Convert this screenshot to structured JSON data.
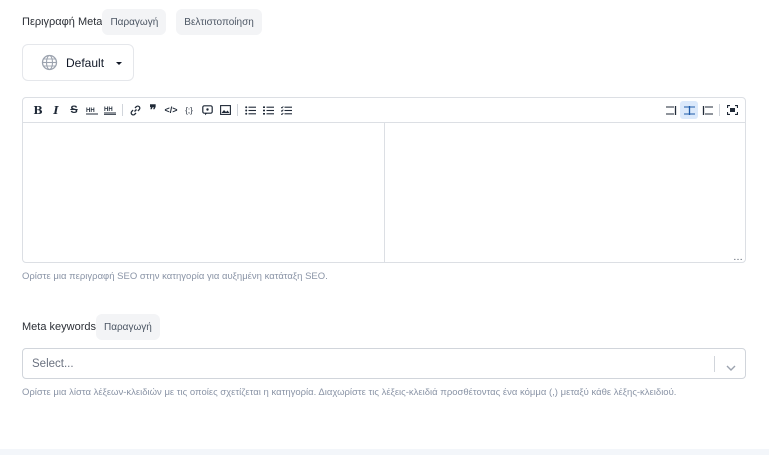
{
  "meta_description": {
    "label": "Περιγραφή Meta",
    "pills": [
      "Παραγωγή",
      "Βελτιστοποίηση"
    ],
    "locale_button": {
      "label": "Default",
      "icon": "globe-icon"
    },
    "toolbar_left": [
      "bold-icon",
      "italic-icon",
      "strikethrough-icon",
      "heading-icon",
      "heading-alt-icon",
      "link-icon",
      "quote-icon",
      "code-icon",
      "code-block-icon",
      "comment-icon",
      "image-icon",
      "unordered-list-icon",
      "ordered-list-icon",
      "checklist-icon"
    ],
    "toolbar_right": [
      "editor-only-icon",
      "split-view-icon",
      "preview-only-icon",
      "fullscreen-icon"
    ],
    "help": "Ορίστε μια περιγραφή SEO στην κατηγορία για αυξημένη κατάταξη SEO."
  },
  "meta_keywords": {
    "label": "Meta keywords",
    "pills": [
      "Παραγωγή"
    ],
    "select_placeholder": "Select...",
    "help": "Ορίστε μια λίστα λέξεων-κλειδιών με τις οποίες σχετίζεται η κατηγορία. Διαχωρίστε τις λέξεις-κλειδιά προσθέτοντας ένα κόμμα (,) μεταξύ κάθε λέξης-κλειδιού."
  },
  "colors": {
    "accent_active": "#dbe9fb",
    "help_text": "#8a94a6",
    "pill_bg": "#f3f4f6"
  }
}
